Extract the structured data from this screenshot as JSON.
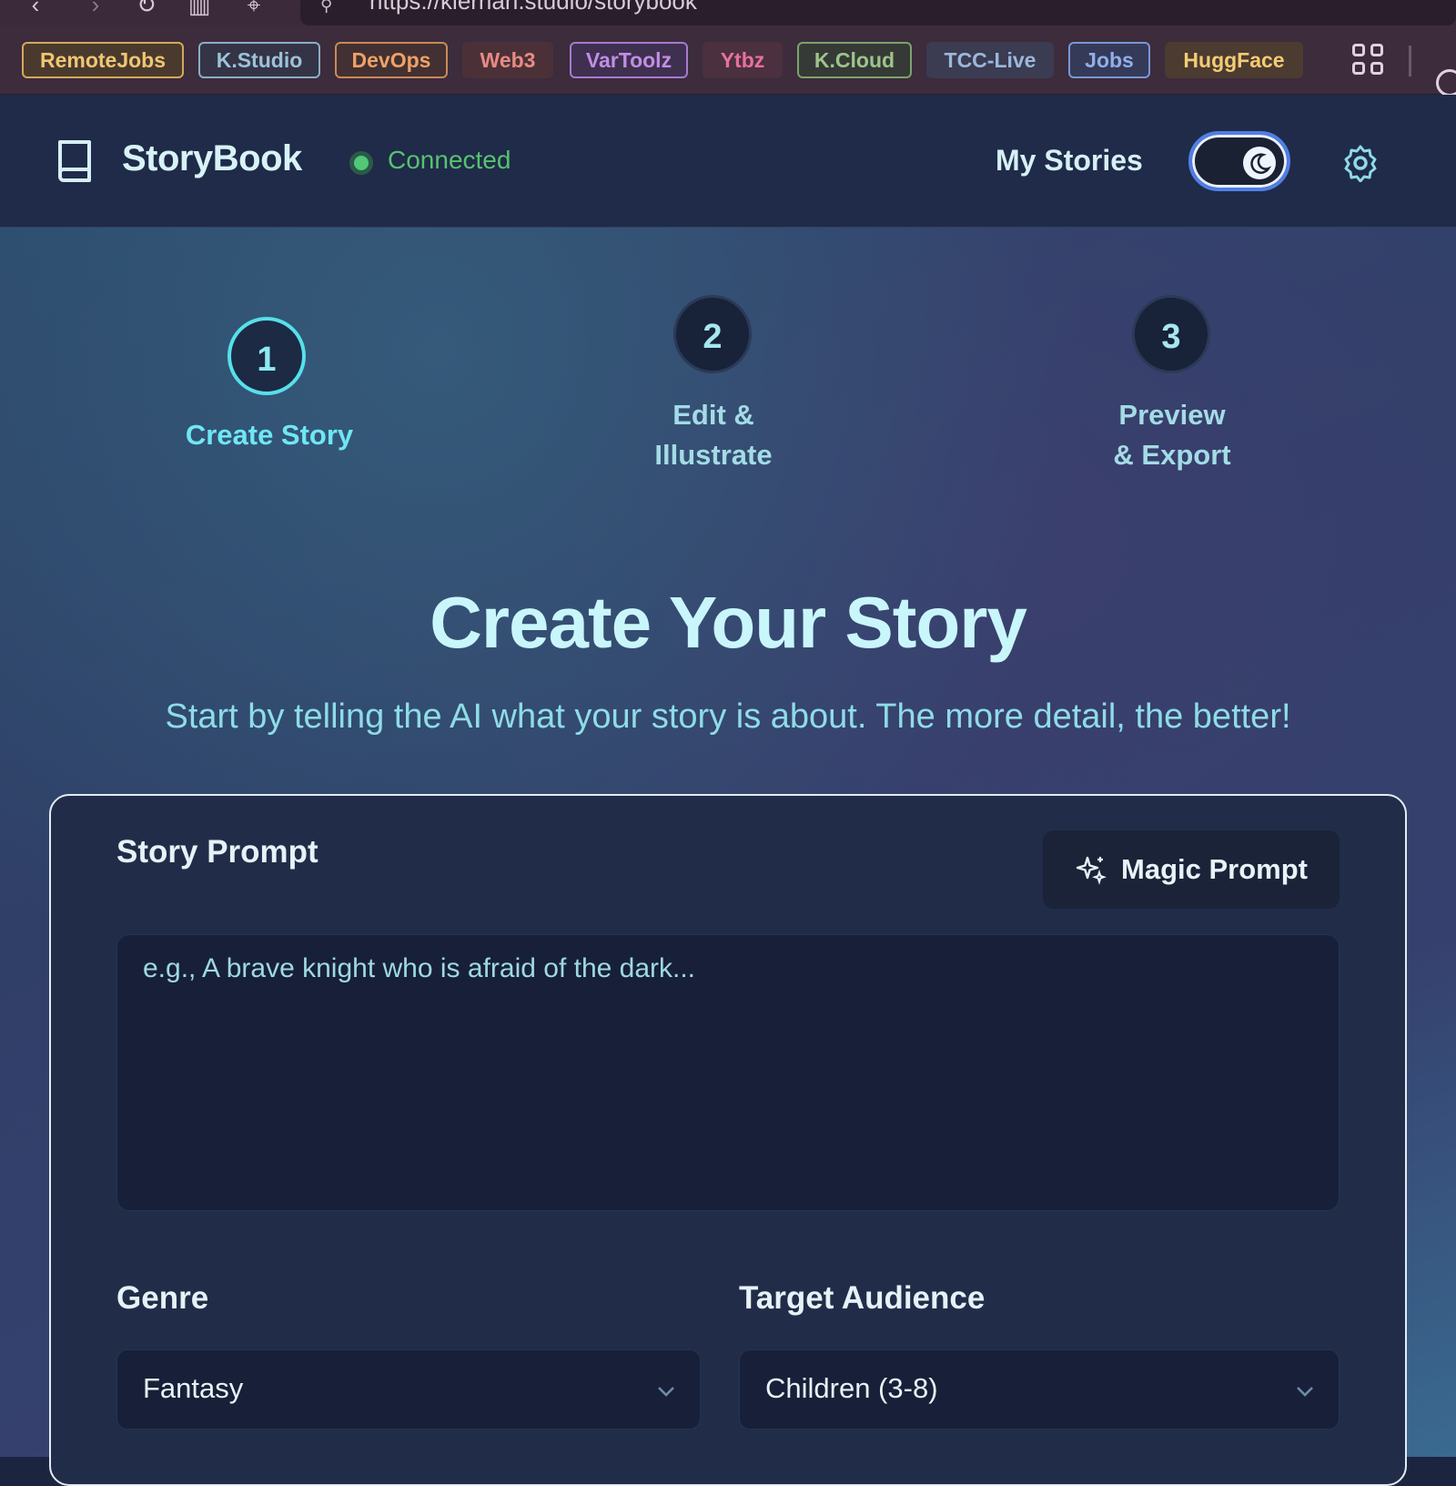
{
  "browser": {
    "url": "https://kiernan.studio/storybook",
    "bookmarks": [
      {
        "label": "RemoteJobs",
        "color": "#f0c673",
        "bg": "#4a3a2e",
        "border": "#d4a85a"
      },
      {
        "label": "K.Studio",
        "color": "#9cc3d8",
        "bg": "#353447",
        "border": "#8aaec4"
      },
      {
        "label": "DevOps",
        "color": "#eea267",
        "bg": "#433032",
        "border": "#c98a57"
      },
      {
        "label": "Web3",
        "color": "#e98a84",
        "bg": "#4b3137",
        "border": "#4b3137"
      },
      {
        "label": "VarToolz",
        "color": "#c08ee6",
        "bg": "#3f3050",
        "border": "#a77ad0"
      },
      {
        "label": "Ytbz",
        "color": "#e8719c",
        "bg": "#4b3040",
        "border": "#4b3040"
      },
      {
        "label": "K.Cloud",
        "color": "#9ec48c",
        "bg": "#363a36",
        "border": "#7ea36d"
      },
      {
        "label": "TCC-Live",
        "color": "#9bb8db",
        "bg": "#3b3b52",
        "border": "#3b3b52"
      },
      {
        "label": "Jobs",
        "color": "#8fb0ea",
        "bg": "#363a59",
        "border": "#7a97d4"
      },
      {
        "label": "HuggFace",
        "color": "#f4cc74",
        "bg": "#4c3b30",
        "border": "#4c3b30"
      }
    ]
  },
  "header": {
    "brand": "StoryBook",
    "status": "Connected",
    "my_stories": "My Stories"
  },
  "steps": [
    {
      "number": "1",
      "label": "Create Story",
      "active": true
    },
    {
      "number": "2",
      "label": "Edit & Illustrate",
      "active": false
    },
    {
      "number": "3",
      "label": "Preview & Export",
      "active": false
    }
  ],
  "hero": {
    "title": "Create Your Story",
    "subtitle": "Start by telling the AI what your story is about. The more detail, the better!"
  },
  "form": {
    "prompt_label": "Story Prompt",
    "magic_label": "Magic Prompt",
    "prompt_placeholder": "e.g., A brave knight who is afraid of the dark...",
    "prompt_value": "",
    "genre_label": "Genre",
    "genre_value": "Fantasy",
    "audience_label": "Target Audience",
    "audience_value": "Children (3-8)"
  }
}
